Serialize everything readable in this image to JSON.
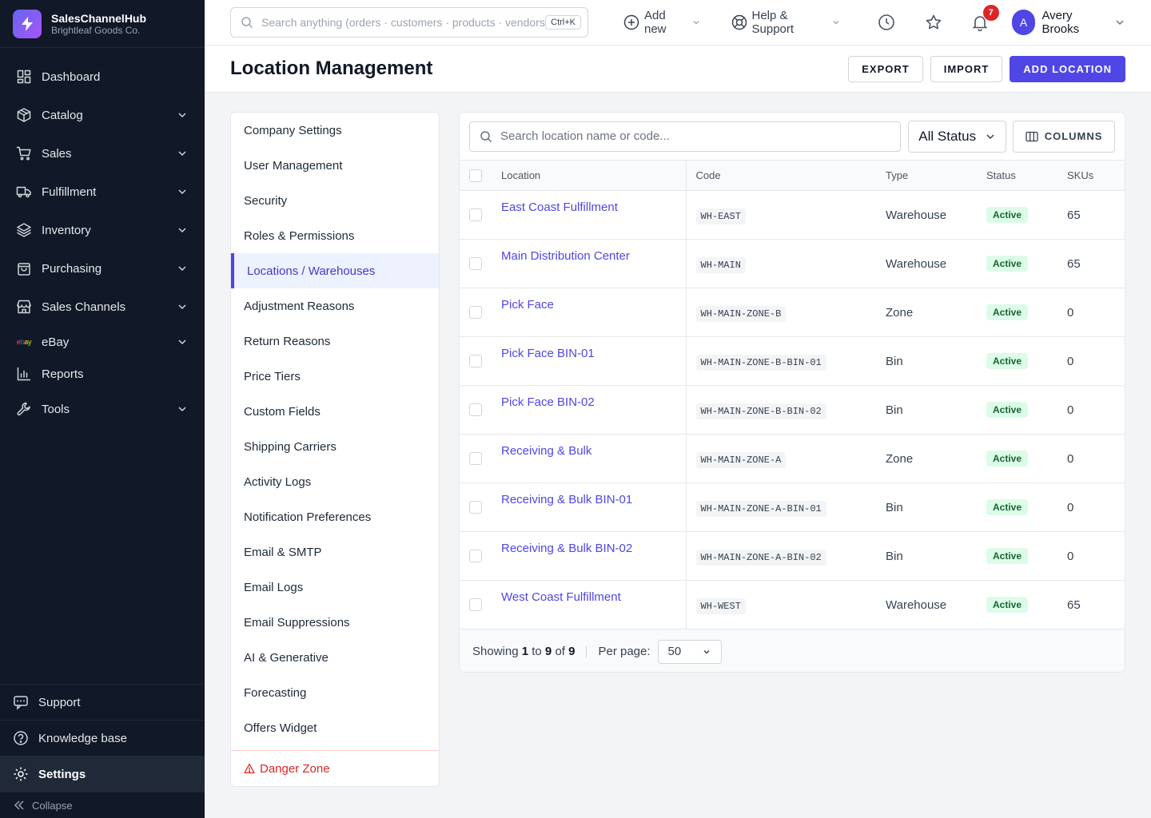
{
  "brand": {
    "name": "SalesChannelHub",
    "company": "Brightleaf Goods Co."
  },
  "nav": [
    {
      "label": "Dashboard",
      "icon": "dashboard-icon",
      "chevron": false
    },
    {
      "label": "Catalog",
      "icon": "box-icon",
      "chevron": true
    },
    {
      "label": "Sales",
      "icon": "cart-icon",
      "chevron": true
    },
    {
      "label": "Fulfillment",
      "icon": "truck-icon",
      "chevron": true
    },
    {
      "label": "Inventory",
      "icon": "layers-icon",
      "chevron": true
    },
    {
      "label": "Purchasing",
      "icon": "bag-icon",
      "chevron": true
    },
    {
      "label": "Sales Channels",
      "icon": "store-icon",
      "chevron": true
    },
    {
      "label": "eBay",
      "icon": "ebay-icon",
      "chevron": true,
      "icon_text": "ebay"
    },
    {
      "label": "Reports",
      "icon": "chart-icon",
      "chevron": false
    },
    {
      "label": "Tools",
      "icon": "wrench-icon",
      "chevron": true
    }
  ],
  "sidebar_bottom": {
    "support": "Support",
    "knowledge_base": "Knowledge base",
    "settings": "Settings",
    "collapse": "Collapse"
  },
  "topbar": {
    "search_placeholder": "Search anything (orders · customers · products · vendors)",
    "shortcut": "Ctrl+K",
    "add_new": "Add new",
    "help": "Help & Support",
    "notification_count": "7",
    "user_initial": "A",
    "user_name": "Avery Brooks"
  },
  "page": {
    "title": "Location Management",
    "export": "EXPORT",
    "import": "IMPORT",
    "add": "ADD LOCATION"
  },
  "settings_menu": {
    "items": [
      "Company Settings",
      "User Management",
      "Security",
      "Roles & Permissions",
      "Locations / Warehouses",
      "Adjustment Reasons",
      "Return Reasons",
      "Price Tiers",
      "Custom Fields",
      "Shipping Carriers",
      "Activity Logs",
      "Notification Preferences",
      "Email & SMTP",
      "Email Logs",
      "Email Suppressions",
      "AI & Generative",
      "Forecasting",
      "Offers Widget"
    ],
    "active_index": 4,
    "danger": "Danger Zone"
  },
  "table": {
    "search_placeholder": "Search location name or code...",
    "status_filter": "All Status",
    "columns_btn": "COLUMNS",
    "headers": {
      "location": "Location",
      "code": "Code",
      "type": "Type",
      "status": "Status",
      "skus": "SKUs"
    },
    "rows": [
      {
        "location": "East Coast Fulfillment",
        "code": "WH-EAST",
        "type": "Warehouse",
        "status": "Active",
        "skus": "65"
      },
      {
        "location": "Main Distribution Center",
        "code": "WH-MAIN",
        "type": "Warehouse",
        "status": "Active",
        "skus": "65"
      },
      {
        "location": "Pick Face",
        "code": "WH-MAIN-ZONE-B",
        "type": "Zone",
        "status": "Active",
        "skus": "0"
      },
      {
        "location": "Pick Face BIN-01",
        "code": "WH-MAIN-ZONE-B-BIN-01",
        "type": "Bin",
        "status": "Active",
        "skus": "0"
      },
      {
        "location": "Pick Face BIN-02",
        "code": "WH-MAIN-ZONE-B-BIN-02",
        "type": "Bin",
        "status": "Active",
        "skus": "0"
      },
      {
        "location": "Receiving & Bulk",
        "code": "WH-MAIN-ZONE-A",
        "type": "Zone",
        "status": "Active",
        "skus": "0"
      },
      {
        "location": "Receiving & Bulk BIN-01",
        "code": "WH-MAIN-ZONE-A-BIN-01",
        "type": "Bin",
        "status": "Active",
        "skus": "0"
      },
      {
        "location": "Receiving & Bulk BIN-02",
        "code": "WH-MAIN-ZONE-A-BIN-02",
        "type": "Bin",
        "status": "Active",
        "skus": "0"
      },
      {
        "location": "West Coast Fulfillment",
        "code": "WH-WEST",
        "type": "Warehouse",
        "status": "Active",
        "skus": "65"
      }
    ],
    "pager": {
      "showing": "Showing",
      "from": "1",
      "to_word": "to",
      "to": "9",
      "of_word": "of",
      "total": "9",
      "per_page_label": "Per page:",
      "per_page": "50"
    }
  },
  "colors": {
    "accent": "#4f46e5",
    "sidebar": "#111827",
    "danger": "#dc2626",
    "success_bg": "#dcfce7"
  }
}
